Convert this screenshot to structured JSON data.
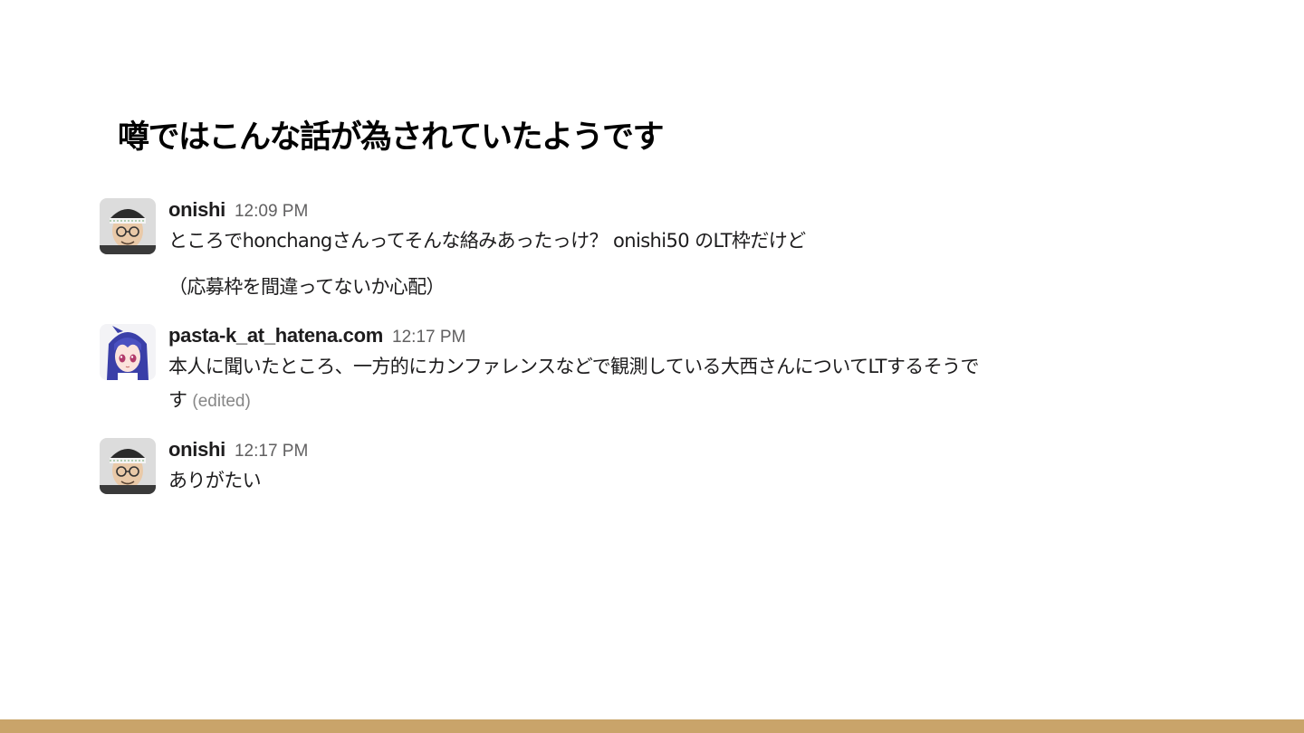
{
  "slide": {
    "title": "噂ではこんな話が為されていたようです"
  },
  "messages": [
    {
      "avatar": "person-with-headband-avatar",
      "username": "onishi",
      "timestamp": "12:09 PM",
      "lines": [
        "ところでhonchangさんってそんな絡みあったっけ？ onishi50 のLT枠だけど",
        "（応募枠を間違ってないか心配）"
      ]
    },
    {
      "avatar": "anime-character-avatar",
      "username": "pasta-k_at_hatena.com",
      "timestamp": "12:17 PM",
      "lines": [
        "本人に聞いたところ、一方的にカンファレンスなどで観測している大西さんについてLTするそうで",
        "す"
      ],
      "edited_label": "(edited)"
    },
    {
      "avatar": "person-with-headband-avatar",
      "username": "onishi",
      "timestamp": "12:17 PM",
      "lines": [
        "ありがたい"
      ]
    }
  ],
  "colors": {
    "footer_bar": "#c9a46a",
    "username": "#1d1c1d",
    "timestamp": "#616061",
    "edited": "#868686"
  }
}
